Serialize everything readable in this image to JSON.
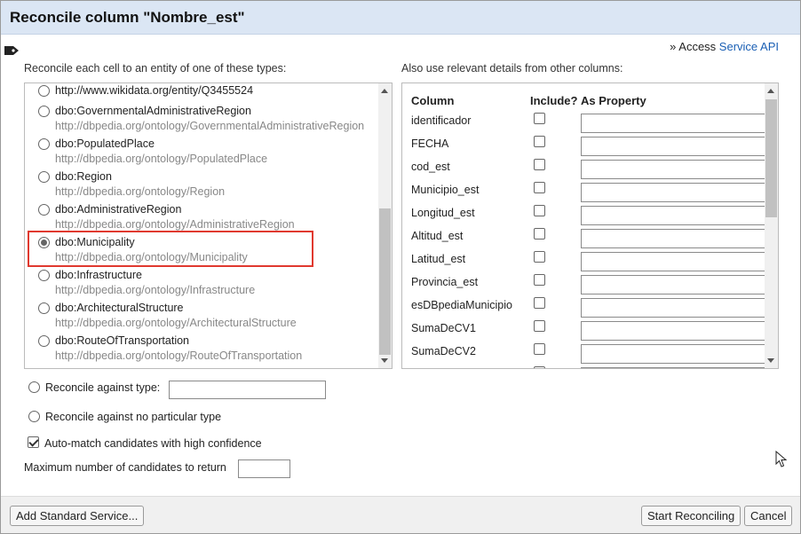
{
  "dialog": {
    "title": "Reconcile column \"Nombre_est\""
  },
  "access": {
    "prefix": "» Access ",
    "link": "Service API"
  },
  "types_section": {
    "label": "Reconcile each cell to an entity of one of these types:",
    "items": [
      {
        "name": "http://www.wikidata.org/entity/Q3455524",
        "uri": "",
        "selected": false
      },
      {
        "name": "dbo:GovernmentalAdministrativeRegion",
        "uri": "http://dbpedia.org/ontology/GovernmentalAdministrativeRegion",
        "selected": false
      },
      {
        "name": "dbo:PopulatedPlace",
        "uri": "http://dbpedia.org/ontology/PopulatedPlace",
        "selected": false
      },
      {
        "name": "dbo:Region",
        "uri": "http://dbpedia.org/ontology/Region",
        "selected": false
      },
      {
        "name": "dbo:AdministrativeRegion",
        "uri": "http://dbpedia.org/ontology/AdministrativeRegion",
        "selected": false
      },
      {
        "name": "dbo:Municipality",
        "uri": "http://dbpedia.org/ontology/Municipality",
        "selected": true
      },
      {
        "name": "dbo:Infrastructure",
        "uri": "http://dbpedia.org/ontology/Infrastructure",
        "selected": false
      },
      {
        "name": "dbo:ArchitecturalStructure",
        "uri": "http://dbpedia.org/ontology/ArchitecturalStructure",
        "selected": false
      },
      {
        "name": "dbo:RouteOfTransportation",
        "uri": "http://dbpedia.org/ontology/RouteOfTransportation",
        "selected": false
      }
    ]
  },
  "columns_section": {
    "label": "Also use relevant details from other columns:",
    "headers": {
      "column": "Column",
      "include": "Include?",
      "property": "As Property"
    },
    "rows": [
      {
        "name": "identificador",
        "include": false,
        "property": ""
      },
      {
        "name": "FECHA",
        "include": false,
        "property": ""
      },
      {
        "name": "cod_est",
        "include": false,
        "property": ""
      },
      {
        "name": "Municipio_est",
        "include": false,
        "property": ""
      },
      {
        "name": "Longitud_est",
        "include": false,
        "property": ""
      },
      {
        "name": "Altitud_est",
        "include": false,
        "property": ""
      },
      {
        "name": "Latitud_est",
        "include": false,
        "property": ""
      },
      {
        "name": "Provincia_est",
        "include": false,
        "property": ""
      },
      {
        "name": "esDBpediaMunicipio",
        "include": false,
        "property": ""
      },
      {
        "name": "SumaDeCV1",
        "include": false,
        "property": ""
      },
      {
        "name": "SumaDeCV2",
        "include": false,
        "property": ""
      }
    ]
  },
  "options": {
    "against_type_label": "Reconcile against type:",
    "against_type_value": "",
    "no_type_label": "Reconcile against no particular type",
    "automatch_label": "Auto-match candidates with high confidence",
    "automatch_checked": true,
    "max_candidates_label": "Maximum number of candidates to return",
    "max_candidates_value": ""
  },
  "footer": {
    "add_service_label": "Add Standard Service...",
    "start_label": "Start Reconciling",
    "cancel_label": "Cancel"
  }
}
